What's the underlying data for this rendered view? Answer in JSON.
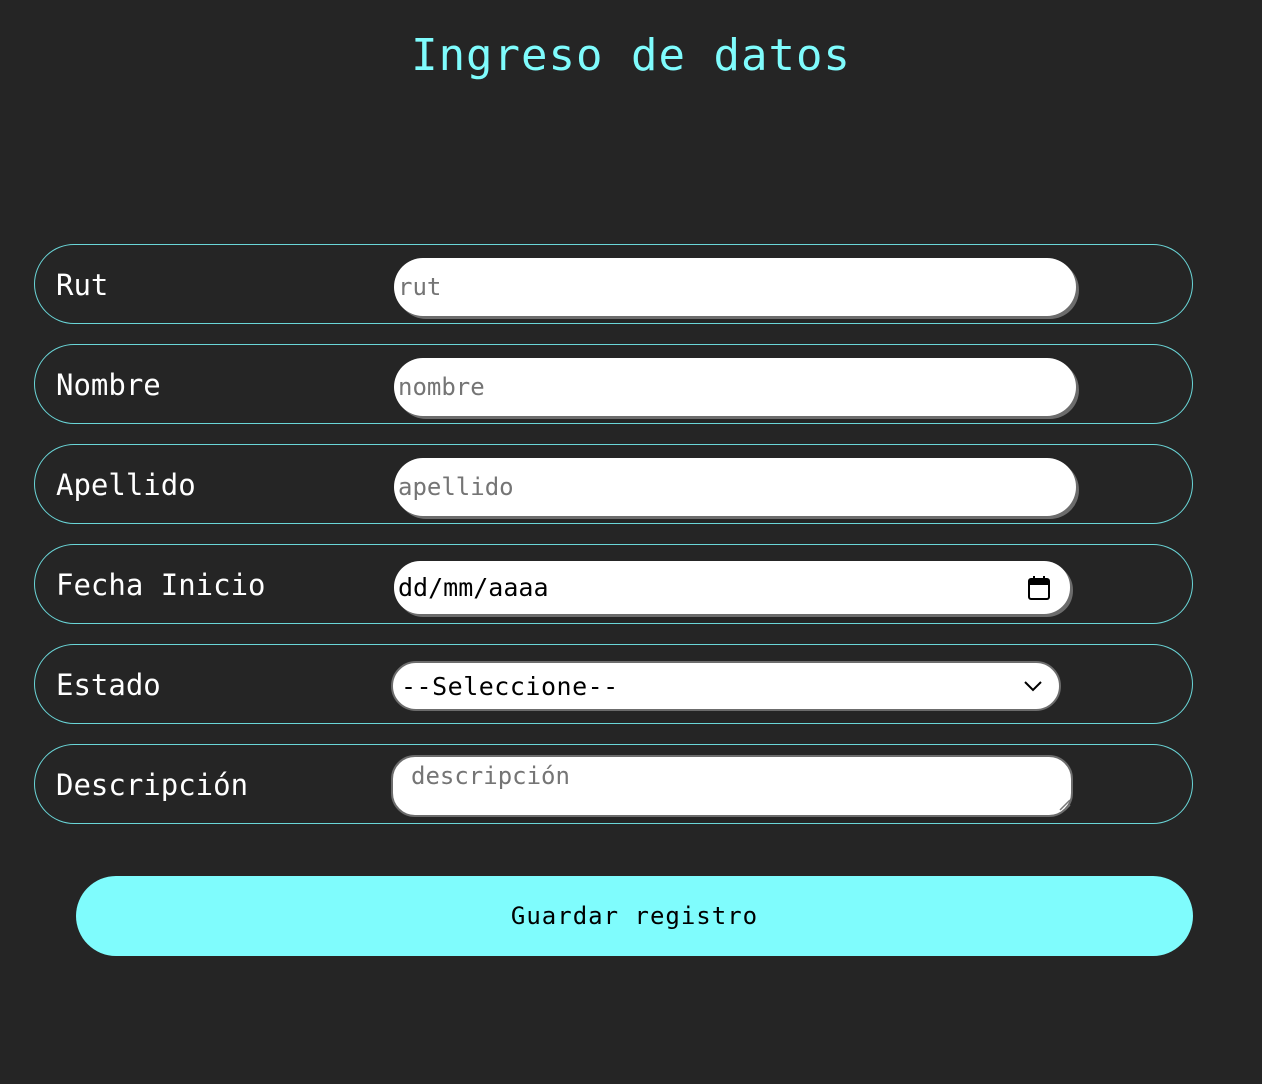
{
  "page": {
    "title": "Ingreso de datos"
  },
  "form": {
    "rut": {
      "label": "Rut",
      "placeholder": "rut",
      "value": ""
    },
    "nombre": {
      "label": "Nombre",
      "placeholder": "nombre",
      "value": ""
    },
    "apellido": {
      "label": "Apellido",
      "placeholder": "apellido",
      "value": ""
    },
    "fecha_inicio": {
      "label": "Fecha Inicio",
      "display": "dd/mm/aaaa",
      "icon": "calendar-icon"
    },
    "estado": {
      "label": "Estado",
      "selected": "--Seleccione--",
      "icon": "chevron-down-icon"
    },
    "descripcion": {
      "label": "Descripción",
      "placeholder": "descripción",
      "value": ""
    },
    "submit_label": "Guardar registro"
  },
  "colors": {
    "background": "#252525",
    "accent": "#7ffcfd",
    "row_border": "#6ad6d8",
    "field_shadow": "#6c6c6c"
  }
}
